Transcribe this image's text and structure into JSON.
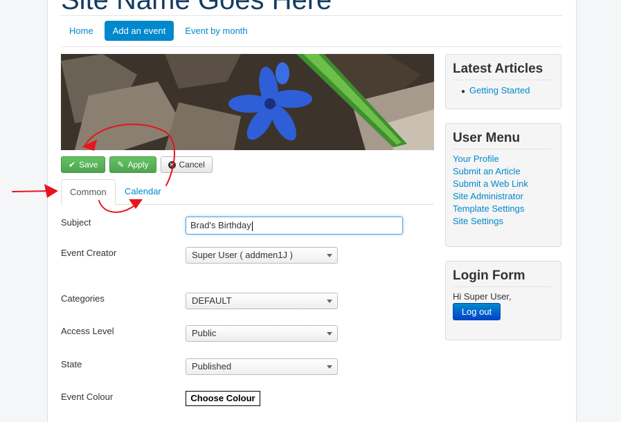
{
  "site": {
    "title": "Site Name Goes Here"
  },
  "nav": {
    "items": [
      "Home",
      "Add an event",
      "Event by month"
    ],
    "active": "Add an event"
  },
  "toolbar": {
    "save": "Save",
    "apply": "Apply",
    "cancel": "Cancel"
  },
  "tabs": {
    "common": "Common",
    "calendar": "Calendar",
    "active": "Common"
  },
  "form": {
    "subject_label": "Subject",
    "subject_value": "Brad's Birthday",
    "creator_label": "Event Creator",
    "creator_value": "Super User ( addmen1J )",
    "categories_label": "Categories",
    "categories_value": "DEFAULT",
    "access_label": "Access Level",
    "access_value": "Public",
    "state_label": "State",
    "state_value": "Published",
    "colour_label": "Event Colour",
    "colour_button": "Choose Colour"
  },
  "latest_articles": {
    "title": "Latest Articles",
    "items": [
      "Getting Started"
    ]
  },
  "user_menu": {
    "title": "User Menu",
    "items": [
      "Your Profile",
      "Submit an Article",
      "Submit a Web Link",
      "Site Administrator",
      "Template Settings",
      "Site Settings"
    ]
  },
  "login_form": {
    "title": "Login Form",
    "greeting": "Hi Super User,",
    "logout": "Log out"
  },
  "colors": {
    "accent": "#0088cc",
    "success": "#51a351",
    "annotation": "#e8141c"
  }
}
